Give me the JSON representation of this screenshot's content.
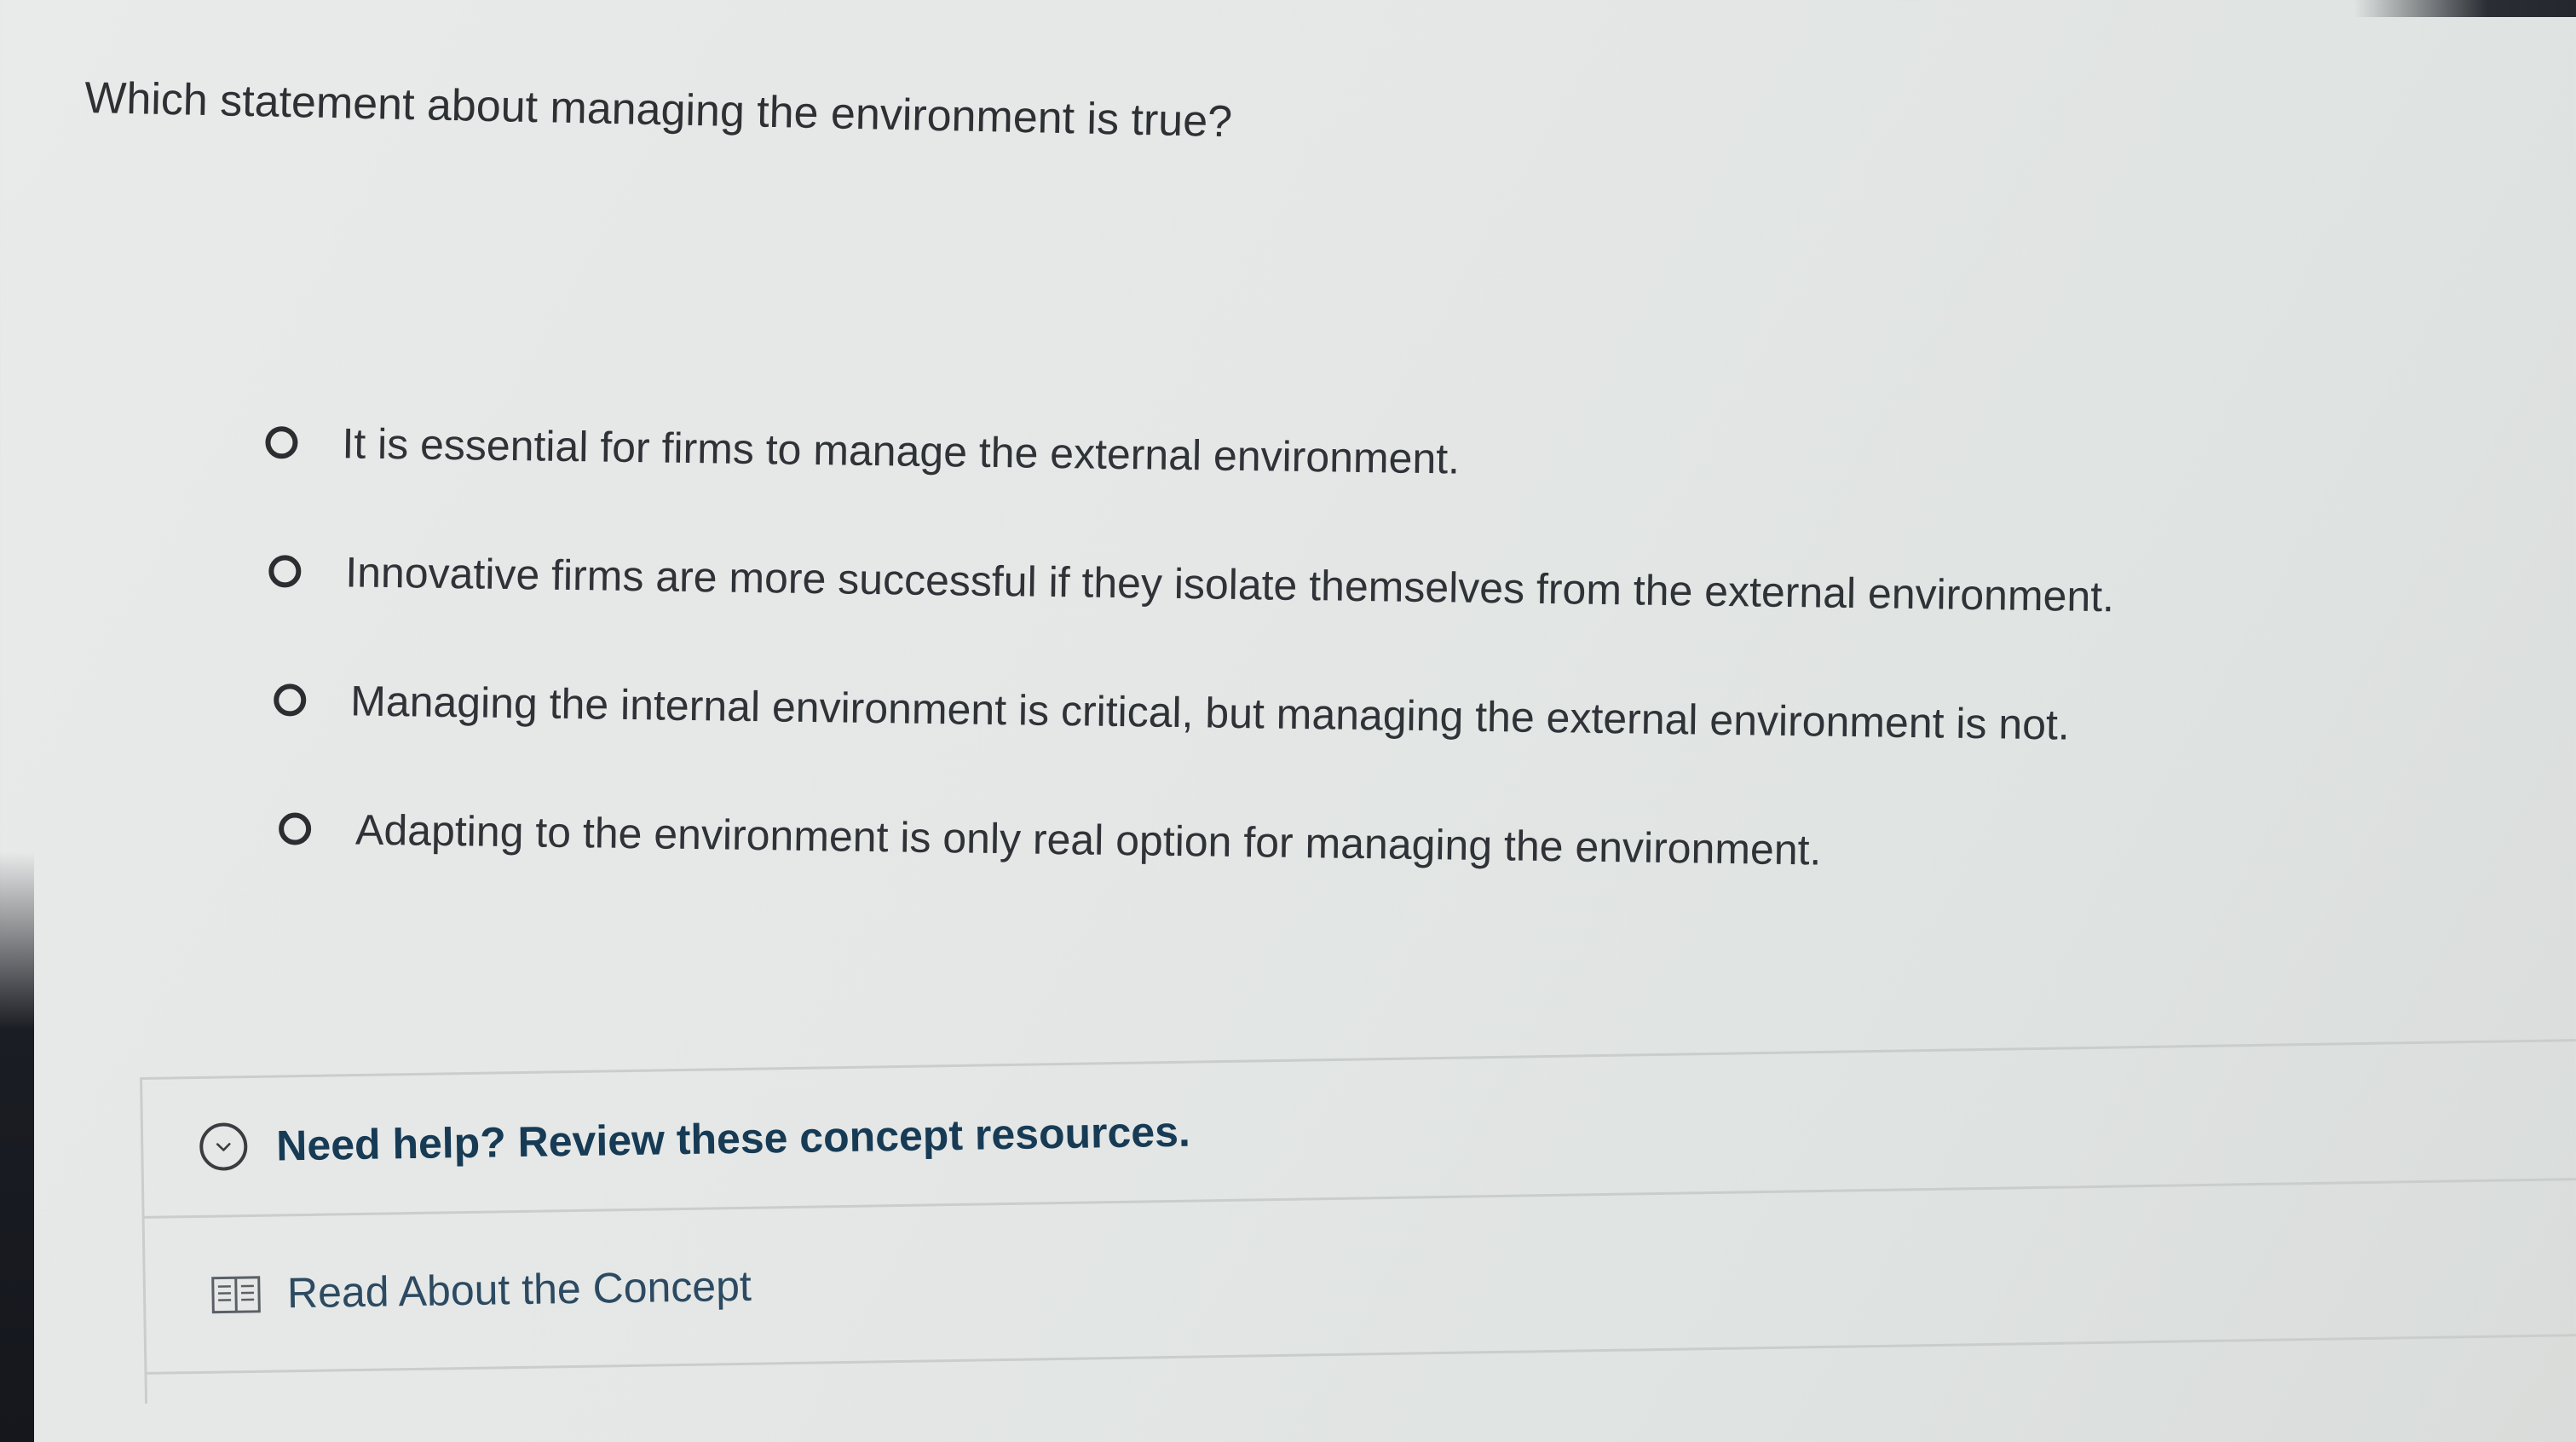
{
  "question": {
    "text": "Which statement about managing the environment is true?"
  },
  "options": [
    {
      "label": "It is essential for firms to manage the external environment."
    },
    {
      "label": "Innovative firms are more successful if they isolate themselves from the external environment."
    },
    {
      "label": "Managing the internal environment is critical, but managing the external environment is not."
    },
    {
      "label": "Adapting to the environment is only real option for managing the environment."
    }
  ],
  "help": {
    "title": "Need help? Review these concept resources.",
    "icon": "chevron-down-circle-icon",
    "resources": [
      {
        "label": "Read About the Concept",
        "icon": "book-icon"
      }
    ]
  },
  "colors": {
    "help_title": "#173b55",
    "resource_link": "#2c4a61"
  }
}
